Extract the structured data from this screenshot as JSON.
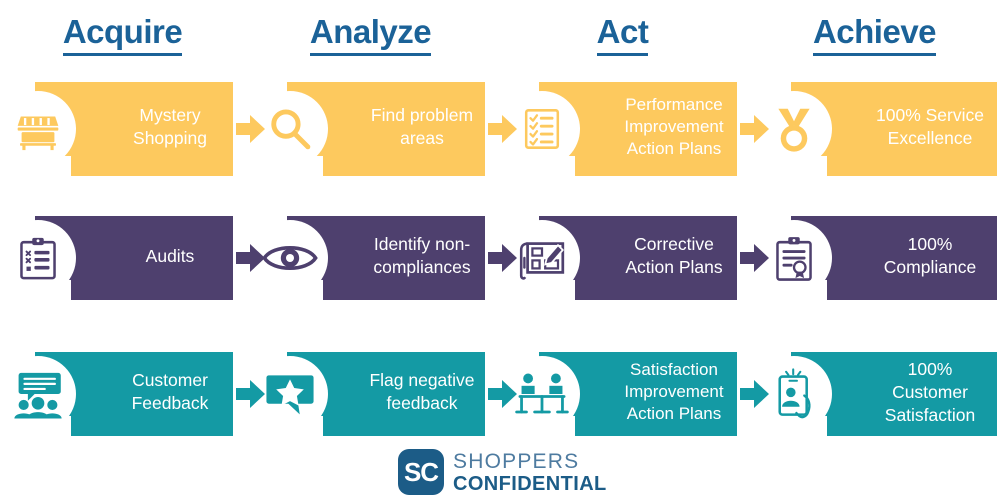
{
  "headings": [
    {
      "label": "Acquire"
    },
    {
      "label": "Analyze"
    },
    {
      "label": "Act"
    },
    {
      "label": "Achieve"
    }
  ],
  "colors": {
    "yellow": "#FDC95E",
    "purple": "#4E406E",
    "teal": "#149AA4",
    "heading_blue": "#1B6298",
    "logo_blue": "#1C5C87",
    "logo_light_blue": "#4E7BA0",
    "white": "#FFFFFF"
  },
  "rows": [
    {
      "name": "mystery-shopping-row",
      "color": "#FDC95E",
      "cells": [
        {
          "icon": "storefront-icon",
          "label": "Mystery\nShopping"
        },
        {
          "icon": "magnifier-icon",
          "label": "Find problem\nareas"
        },
        {
          "icon": "checklist-icon",
          "label": "Performance\nImprovement\nAction Plans"
        },
        {
          "icon": "medal-icon",
          "label": "100% Service\nExcellence"
        }
      ]
    },
    {
      "name": "audits-row",
      "color": "#4E406E",
      "cells": [
        {
          "icon": "clipboard-checklist-icon",
          "label": "Audits"
        },
        {
          "icon": "eye-icon",
          "label": "Identify non-\ncompliances"
        },
        {
          "icon": "blueprint-edit-icon",
          "label": "Corrective\nAction Plans"
        },
        {
          "icon": "certificate-clipboard-icon",
          "label": "100%\nCompliance"
        }
      ]
    },
    {
      "name": "customer-feedback-row",
      "color": "#149AA4",
      "cells": [
        {
          "icon": "audience-speech-icon",
          "label": "Customer\nFeedback"
        },
        {
          "icon": "star-comment-icon",
          "label": "Flag negative\nfeedback"
        },
        {
          "icon": "meeting-table-icon",
          "label": "Satisfaction\nImprovement\nAction Plans"
        },
        {
          "icon": "mobile-review-icon",
          "label": "100% Customer\nSatisfaction"
        }
      ]
    }
  ],
  "logo": {
    "mark": "SC",
    "line1": "SHOPPERS",
    "line2": "CONFIDENTIAL"
  }
}
